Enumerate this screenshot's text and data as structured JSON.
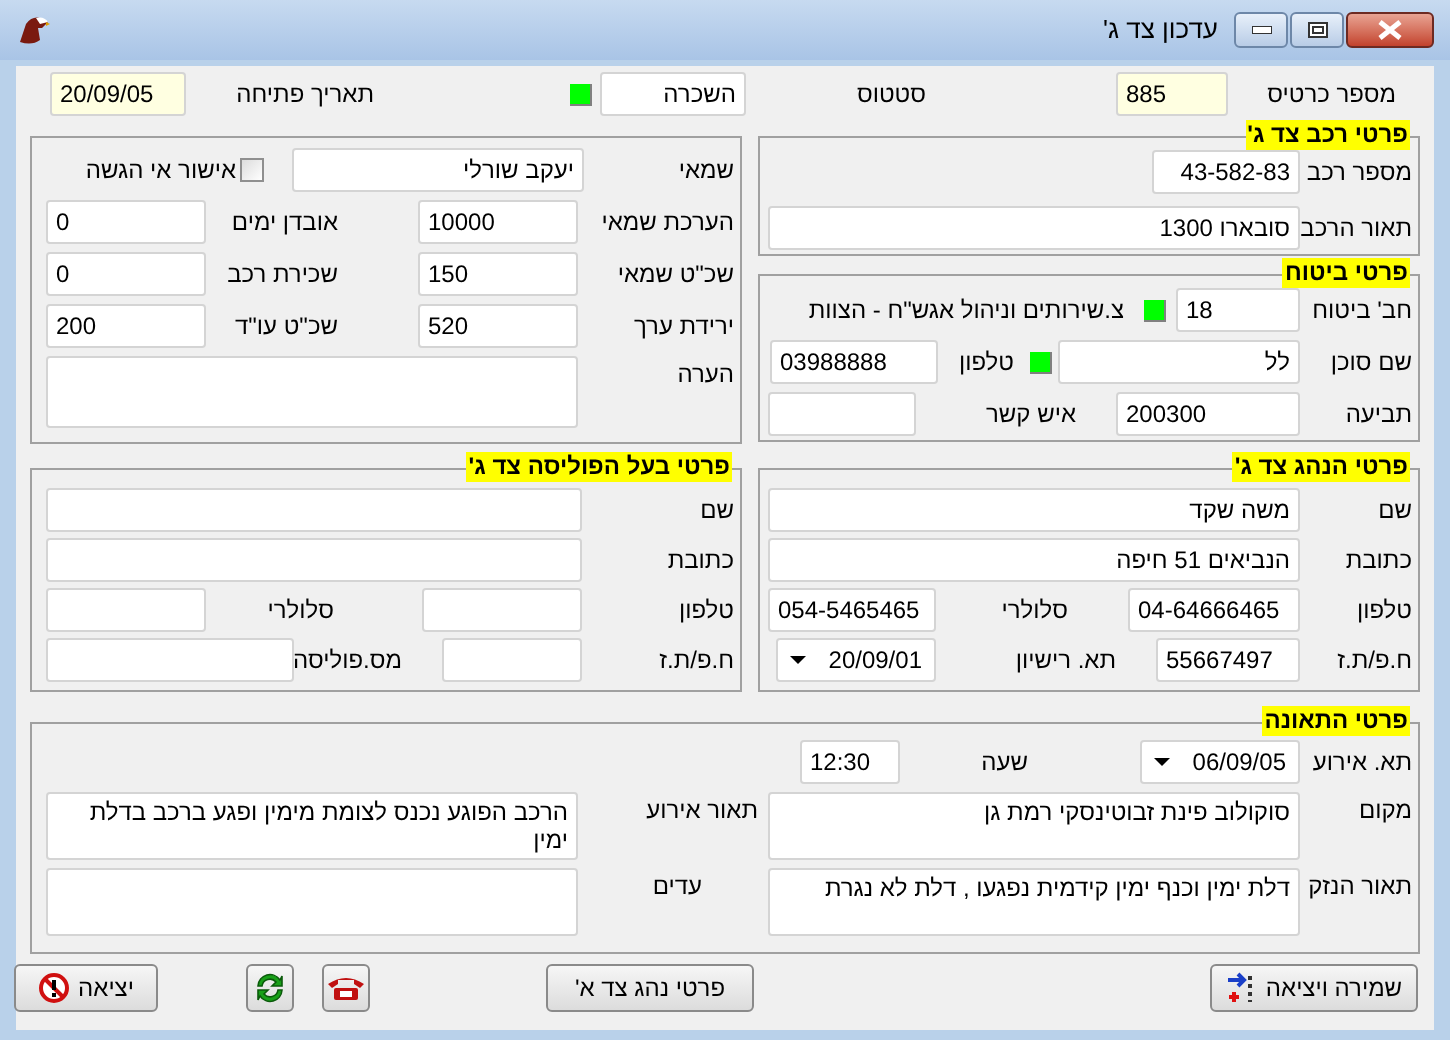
{
  "window": {
    "title": "עדכון צד ג'"
  },
  "header": {
    "card_number": {
      "label": "מספר כרטיס",
      "value": "885"
    },
    "status": {
      "label": "סטטוס",
      "value": "השכרה",
      "indicator_on": true
    },
    "open_date": {
      "label": "תאריך פתיחה",
      "value": "20/09/05"
    }
  },
  "appraisal": {
    "appraiser": {
      "label": "שמאי",
      "value": "יעקב שורלי"
    },
    "no_submission": {
      "label": "אישור אי הגשה",
      "checked": false
    },
    "appraisal_value": {
      "label": "הערכת שמאי",
      "value": "10000"
    },
    "days_lost": {
      "label": "אובדן ימים",
      "value": "0"
    },
    "appraiser_fee": {
      "label": "שכ\"ט שמאי",
      "value": "150"
    },
    "car_rental": {
      "label": "שכירת רכב",
      "value": "0"
    },
    "depreciation": {
      "label": "ירידת ערך",
      "value": "520"
    },
    "lawyer_fee": {
      "label": "שכ\"ט עו\"ד",
      "value": "200"
    },
    "note": {
      "label": "הערה"
    }
  },
  "vehicle": {
    "title": "פרטי רכב צד ג'",
    "plate": {
      "label": "מספר רכב",
      "value": "43-582-83"
    },
    "description": {
      "label": "תאור הרכב",
      "value": "סובארו 1300"
    }
  },
  "insurance": {
    "title": "פרטי ביטוח",
    "company": {
      "label": "חב' ביטוח",
      "value": "18",
      "indicator_on": true,
      "name": "צ.שירותים וניהול אגש\"ח - הצוות"
    },
    "agent": {
      "label": "שם סוכן",
      "value": "לל",
      "indicator_on": true
    },
    "phone": {
      "label": "טלפון",
      "value": "03988888"
    },
    "claim": {
      "label": "תביעה",
      "value": "200300"
    },
    "contact": {
      "label": "איש קשר"
    }
  },
  "policy_holder": {
    "title": "פרטי בעל הפוליסה צד ג'",
    "name": {
      "label": "שם"
    },
    "address": {
      "label": "כתובת"
    },
    "phone": {
      "label": "טלפון"
    },
    "mobile": {
      "label": "סלולרי"
    },
    "id": {
      "label": "ח.פ/ת.ז"
    },
    "policy_no": {
      "label": "מס.פוליסה"
    }
  },
  "driver": {
    "title": "פרטי הנהג צד ג'",
    "name": {
      "label": "שם",
      "value": "משה שקד"
    },
    "address": {
      "label": "כתובת",
      "value": "הנביאים 51  חיפה"
    },
    "phone": {
      "label": "טלפון",
      "value": "04-64666465"
    },
    "mobile": {
      "label": "סלולרי",
      "value": "054-5465465"
    },
    "id": {
      "label": "ח.פ/ת.ז",
      "value": "55667497"
    },
    "license_date": {
      "label": "תא. רישיון",
      "value": "20/09/01"
    }
  },
  "accident": {
    "title": "פרטי התאונה",
    "date": {
      "label": "תא. אירוע",
      "value": "06/09/05"
    },
    "time": {
      "label": "שעה",
      "value": "12:30"
    },
    "place": {
      "label": "מקום",
      "value": "סוקולוב פינת זבוטינסקי רמת גן"
    },
    "event_description": {
      "label": "תאור אירוע",
      "value": "הרכב הפוגע נכנס לצומת מימין ופגע ברכב בדלת ימין"
    },
    "damage_description": {
      "label": "תאור הנזק",
      "value": "דלת ימין וכנף ימין קידמית נפגעו , דלת לא נגרת"
    },
    "witnesses": {
      "label": "עדים"
    }
  },
  "buttons": [
    {
      "kind": "save",
      "label": "שמירה ויציאה"
    },
    {
      "kind": "driver",
      "label": "פרטי נהג צד א'"
    },
    {
      "kind": "phone"
    },
    {
      "kind": "refresh"
    },
    {
      "kind": "exit",
      "label": "יציאה"
    }
  ]
}
